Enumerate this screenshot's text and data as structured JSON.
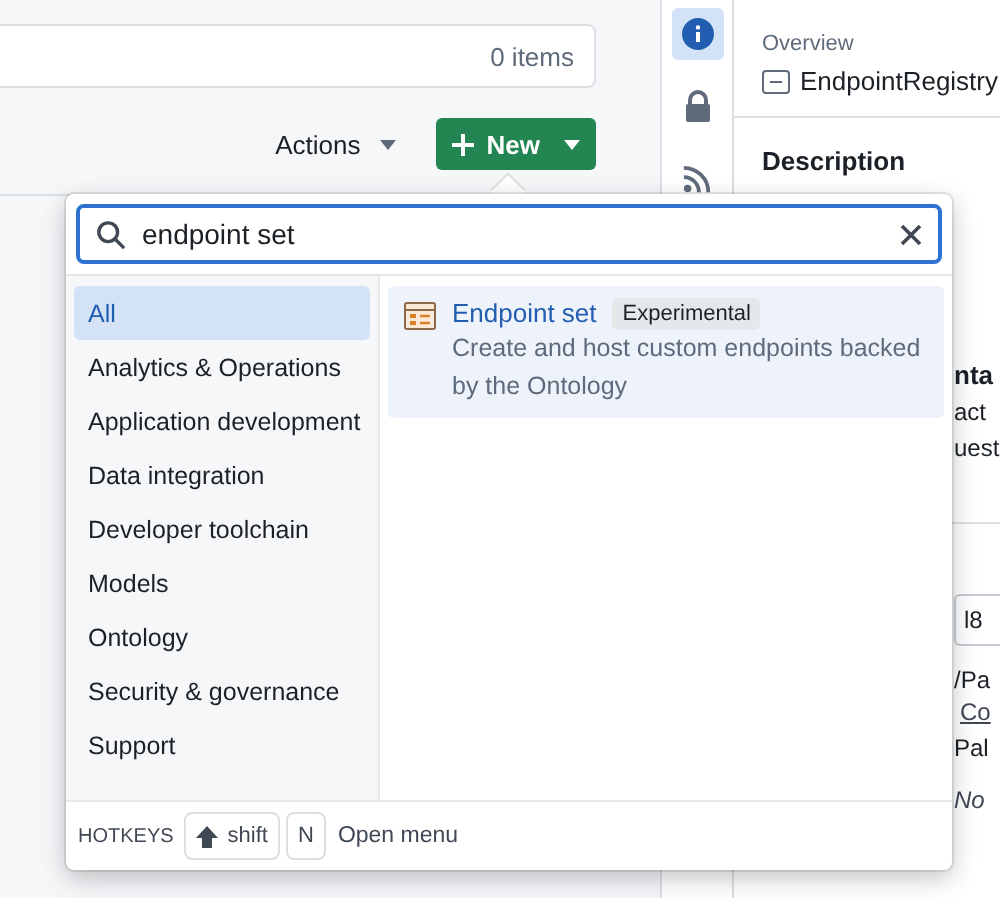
{
  "list_header": {
    "count": "0 items"
  },
  "toolbar": {
    "actions": "Actions",
    "new": "New"
  },
  "rail": [
    {
      "kind": "info",
      "selected": true
    },
    {
      "kind": "lock",
      "selected": false
    },
    {
      "kind": "feed",
      "selected": false
    }
  ],
  "overview": {
    "label": "Overview",
    "name": "EndpointRegistry",
    "description": "Description"
  },
  "side_fragments": [
    {
      "kind": "heading",
      "text": "nta"
    },
    {
      "kind": "line",
      "text": "act"
    },
    {
      "kind": "line",
      "text": "uest"
    },
    {
      "kind": "divider"
    },
    {
      "kind": "field",
      "text": "l8"
    },
    {
      "kind": "line",
      "text": "/Pa"
    },
    {
      "kind": "link",
      "text": "Co"
    },
    {
      "kind": "line",
      "text": "Pal"
    },
    {
      "kind": "italic",
      "text": "No"
    }
  ],
  "popup": {
    "search": {
      "value": "endpoint set"
    },
    "categories": [
      {
        "label": "All",
        "selected": true
      },
      {
        "label": "Analytics & Operations",
        "selected": false
      },
      {
        "label": "Application development",
        "selected": false
      },
      {
        "label": "Data integration",
        "selected": false
      },
      {
        "label": "Developer toolchain",
        "selected": false
      },
      {
        "label": "Models",
        "selected": false
      },
      {
        "label": "Ontology",
        "selected": false
      },
      {
        "label": "Security & governance",
        "selected": false
      },
      {
        "label": "Support",
        "selected": false
      }
    ],
    "results": [
      {
        "title": "Endpoint set",
        "badge": "Experimental",
        "description": "Create and host custom endpoints backed by the Ontology",
        "selected": true
      }
    ],
    "footer": {
      "label": "HOTKEYS",
      "keys": [
        "shift",
        "N"
      ],
      "action": "Open menu"
    }
  }
}
